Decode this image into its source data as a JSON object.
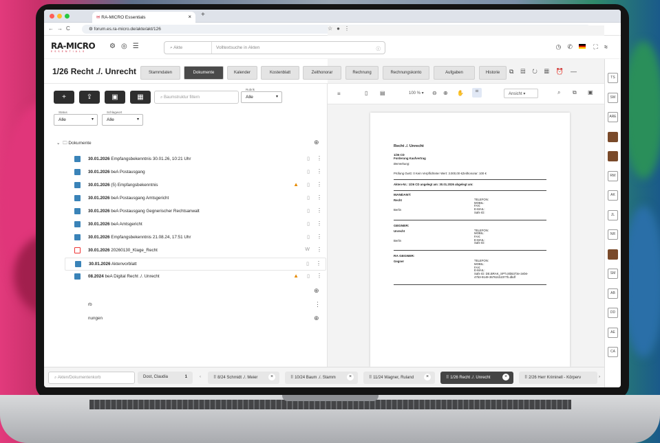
{
  "browser": {
    "tab_title": "RA-MICRO Essentials",
    "url": "forum.es.ra-micro.de/akte/akt/126"
  },
  "app": {
    "logo": "RA-MICRO",
    "logo_sub": "ESSENTIALS",
    "search_scope": "Akte",
    "search_placeholder": "Volltextsuche in Akten"
  },
  "page": {
    "title": "1/26 Recht ./. Unrecht",
    "tabs": [
      "Stammdaten",
      "Dokumente",
      "Kalender",
      "Kostenblatt",
      "Zeithonorar",
      "Rechnung",
      "Rechnungskonto",
      "Aufgaben",
      "Historie"
    ],
    "active_tab": "Dokumente"
  },
  "left": {
    "tree_search_placeholder": "Baumstruktur filtern",
    "filters": [
      {
        "label": "Rubrik",
        "value": "Alle"
      },
      {
        "label": "Status",
        "value": "Alle"
      },
      {
        "label": "Schlagwort",
        "value": "Alle"
      }
    ],
    "root": "Dokumente",
    "rows": [
      {
        "date": "30.01.2026",
        "text": "Empfangsbekenntnis 30.01.26, 10:21 Uhr",
        "warn": false
      },
      {
        "date": "30.01.2026",
        "text": "beA Postausgang",
        "warn": false
      },
      {
        "date": "30.01.2026",
        "text": "(5) Empfangsbekenntnis",
        "warn": true
      },
      {
        "date": "30.01.2026",
        "text": "beA Postausgang Amtsgericht",
        "warn": false
      },
      {
        "date": "30.01.2026",
        "text": "beA Postausgang Gegnerischer Rechtsanwalt",
        "warn": false
      },
      {
        "date": "30.01.2026",
        "text": "beA Amtsgericht",
        "warn": false
      },
      {
        "date": "30.01.2026",
        "text": "Empfangsbekenntnis 21.08.24, 17:51 Uhr",
        "warn": false
      },
      {
        "date": "30.01.2026",
        "text": "20260130_Klage_Recht",
        "warn": false
      },
      {
        "date": "30.01.2026",
        "text": "Aktenvorblatt",
        "warn": false
      },
      {
        "date": "08.2024",
        "text": "beA Digital Recht ./. Unrecht",
        "warn": true
      }
    ],
    "lower_items": [
      "rb",
      "nungen"
    ]
  },
  "preview": {
    "zoom": "100 %",
    "view": "Ansicht",
    "doc": {
      "title": "Recht ./. Unrecht",
      "ref": "1/26 CD",
      "subject": "Forderung Kaufvertrag",
      "note": "Bemerkung:",
      "check": "Prüfung GwG: 0  Kein Verpflichteter  Wert: 3.000,00 €Zeithonorar: 100 €",
      "aktennr": "Akten-Nr.: 1/26 CD   angelegt am: 30.01.2026   abgelegt am:",
      "sections": [
        {
          "head": "MANDANT:",
          "name": "Recht",
          "city": "Berlin",
          "contact": "TELEFON:\nMOBIL:\nFAX:\nE-MAIL:\nSafe ID:"
        },
        {
          "head": "GEGNER:",
          "name": "Unrecht",
          "city": "Berlin",
          "contact": "TELEFON:\nMOBIL:\nFAX:\nE-MAIL:\nSafe ID:"
        },
        {
          "head": "RA GEGNER:",
          "name": "Gegner",
          "city": "",
          "contact": "TELEFON:\nMOBIL:\nFAX:\nE-MAIL:\nSafe ID: DE.BRAK_SPT.c8b5373e-2eb6-\n47b3-9149-36762cb2377b.dbdf"
        }
      ]
    }
  },
  "rail": [
    "TS",
    "SW",
    "ARE",
    "",
    "",
    "RW",
    "AK",
    "JL",
    "NR",
    "",
    "SM",
    "AB",
    "DD",
    "AE",
    "CA"
  ],
  "bottom": {
    "search_placeholder": "Akten/Dokumentenkorb",
    "user": "Dost, Claudia",
    "user_count": "1",
    "open_files": [
      {
        "label": "8/24 Schmidt ./. Meier",
        "active": false
      },
      {
        "label": "10/24 Baum ./. Stamm",
        "active": false
      },
      {
        "label": "11/24 Wagner, Ruland",
        "active": false
      },
      {
        "label": "1/26 Recht ./. Unrecht",
        "active": true
      },
      {
        "label": "2/26 Herr Kriminell - Körperv",
        "active": false
      }
    ]
  },
  "colors": {
    "accent": "#d0243a",
    "primary_button": "#2e2e2e",
    "active_tab": "#4a4a4a"
  }
}
